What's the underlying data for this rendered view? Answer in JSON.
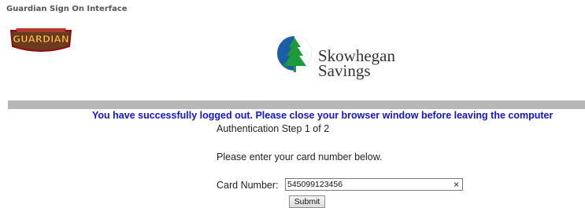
{
  "header": {
    "title": "Guardian Sign On Interface"
  },
  "guardian_logo": {
    "text": "GUARDIAN",
    "icon": "guardian-shield-logo",
    "colors": {
      "shield": "#6b3a1f",
      "text": "#f6c14a",
      "outline": "#8a1010"
    }
  },
  "bank_logo": {
    "line1": "Skowhegan",
    "line2": "Savings",
    "icon": "pine-tree-logo",
    "colors": {
      "circle": "#1c5ea8",
      "tree": "#1e9a3a"
    }
  },
  "message": {
    "logout": "You have successfully logged out. Please close your browser window before leaving the computer"
  },
  "auth": {
    "step": "Authentication Step 1 of 2",
    "prompt": "Please enter your card number below.",
    "card_label": "Card Number:",
    "card_value": "545099123456",
    "clear_icon": "×",
    "submit_label": "Submit"
  },
  "colors": {
    "message": "#1515cc",
    "divider": "#b7b7b7"
  }
}
